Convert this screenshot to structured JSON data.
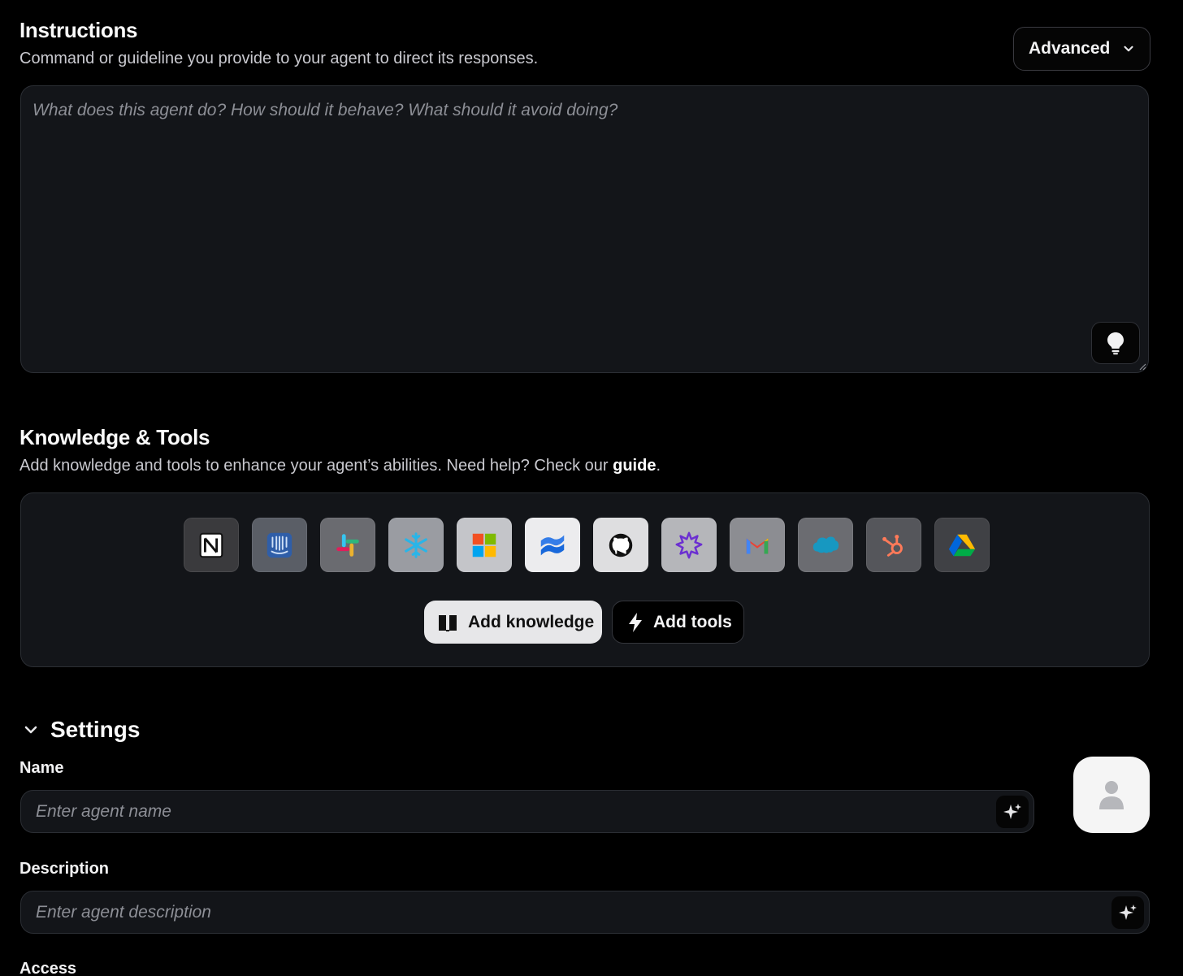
{
  "instructions": {
    "title": "Instructions",
    "subtitle": "Command or guideline you provide to your agent to direct its responses.",
    "advanced_label": "Advanced",
    "placeholder": "What does this agent do? How should it behave? What should it avoid doing?"
  },
  "knowledge_tools": {
    "title": "Knowledge & Tools",
    "subtitle_prefix": "Add knowledge and tools to enhance your agent’s abilities. Need help? Check our ",
    "subtitle_link": "guide",
    "subtitle_suffix": ".",
    "integrations": [
      {
        "name": "notion-icon",
        "bg": "#3a3a3d"
      },
      {
        "name": "intercom-icon",
        "bg": "#5a5e66"
      },
      {
        "name": "slack-icon",
        "bg": "#6a6b70"
      },
      {
        "name": "snowflake-icon",
        "bg": "#9a9ca2"
      },
      {
        "name": "microsoft-icon",
        "bg": "#c4c5c9"
      },
      {
        "name": "confluence-icon",
        "bg": "#ececee"
      },
      {
        "name": "github-icon",
        "bg": "#dedee0"
      },
      {
        "name": "zendesk-icon",
        "bg": "#b5b6ba"
      },
      {
        "name": "gmail-icon",
        "bg": "#8c8d92"
      },
      {
        "name": "salesforce-icon",
        "bg": "#6b6c71"
      },
      {
        "name": "hubspot-icon",
        "bg": "#55565b"
      },
      {
        "name": "google-drive-icon",
        "bg": "#404145"
      }
    ],
    "add_knowledge_label": "Add knowledge",
    "add_tools_label": "Add tools"
  },
  "settings": {
    "title": "Settings",
    "name_label": "Name",
    "name_placeholder": "Enter agent name",
    "description_label": "Description",
    "description_placeholder": "Enter agent description",
    "access_label": "Access"
  }
}
